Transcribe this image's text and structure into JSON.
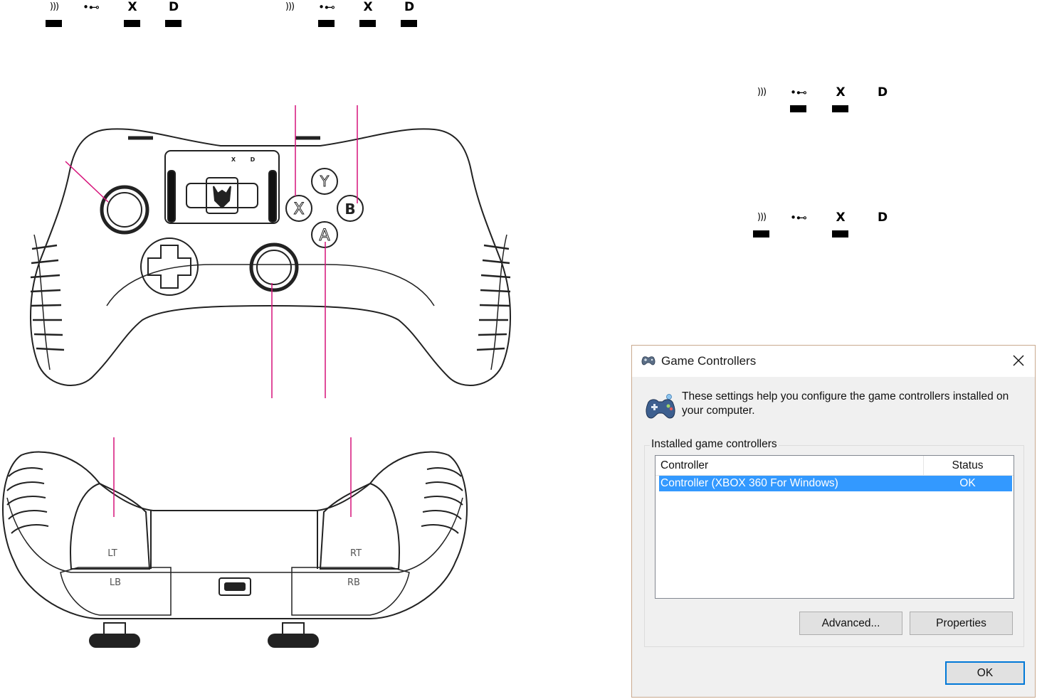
{
  "indicator_panels": [
    {
      "labels": {
        "wireless": "))) ",
        "usb": "•⊷",
        "x_mode": "X",
        "d_mode": "D"
      },
      "lit": [
        true,
        false,
        true,
        true
      ]
    },
    {
      "labels": {
        "wireless": "))) ",
        "usb": "•⊷",
        "x_mode": "X",
        "d_mode": "D"
      },
      "lit": [
        false,
        true,
        true,
        true
      ]
    },
    {
      "labels": {
        "wireless": "))) ",
        "usb": "•⊷",
        "x_mode": "X",
        "d_mode": "D"
      },
      "lit": [
        false,
        true,
        true,
        false
      ]
    },
    {
      "labels": {
        "wireless": "))) ",
        "usb": "•⊷",
        "x_mode": "X",
        "d_mode": "D"
      },
      "lit": [
        true,
        false,
        true,
        false
      ]
    }
  ],
  "controller_front": {
    "face_buttons": {
      "x": "X",
      "y": "Y",
      "b": "B",
      "a": "A"
    },
    "mini_leds": [
      "X",
      "D"
    ]
  },
  "controller_top": {
    "lt": "LT",
    "rt": "RT",
    "lb": "LB",
    "rb": "RB"
  },
  "colors": {
    "callout": "#d6127a",
    "selection": "#3399ff",
    "dialog_bg": "#f0f0f0",
    "focus": "#0078d7"
  },
  "dialog": {
    "title": "Game Controllers",
    "intro": "These settings help you configure the game controllers installed on your computer.",
    "group_label": "Installed game controllers",
    "columns": {
      "controller": "Controller",
      "status": "Status"
    },
    "rows": [
      {
        "controller": "Controller (XBOX 360 For Windows)",
        "status": "OK"
      }
    ],
    "buttons": {
      "advanced": "Advanced...",
      "properties": "Properties",
      "ok": "OK"
    }
  }
}
